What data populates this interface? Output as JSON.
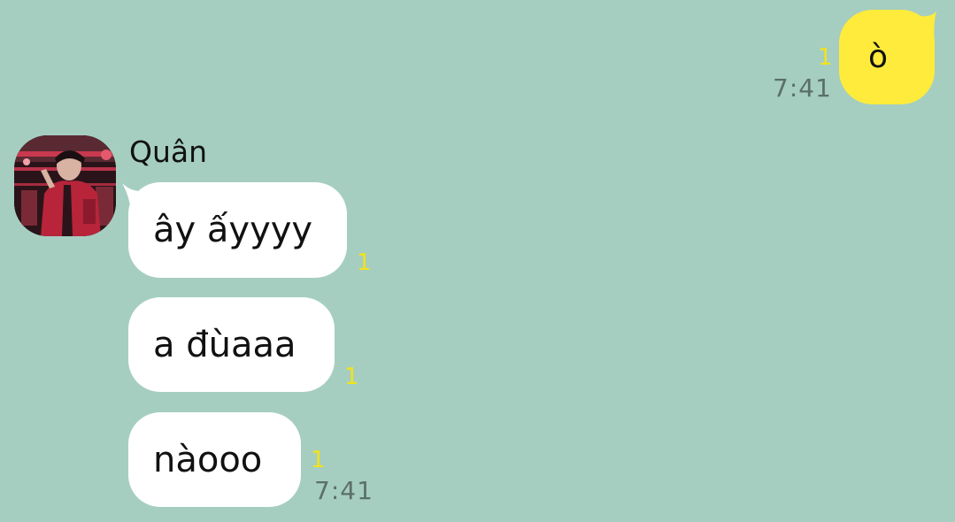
{
  "conversation": {
    "outgoing": [
      {
        "text": "ò",
        "unread": "1",
        "time": "7:41"
      }
    ],
    "incoming": {
      "sender": "Quân",
      "messages": [
        {
          "text": "ây ấyyyy",
          "unread": "1"
        },
        {
          "text": "a đùaaa",
          "unread": "1"
        },
        {
          "text": "nàooo",
          "unread": "1",
          "time": "7:41"
        }
      ]
    }
  },
  "colors": {
    "background": "#a5cec1",
    "outgoing_bubble": "#ffeb3b",
    "incoming_bubble": "#ffffff",
    "unread_count": "#f2e21d",
    "timestamp": "#5b6f69"
  },
  "icons": {
    "avatar": "profile-photo"
  }
}
